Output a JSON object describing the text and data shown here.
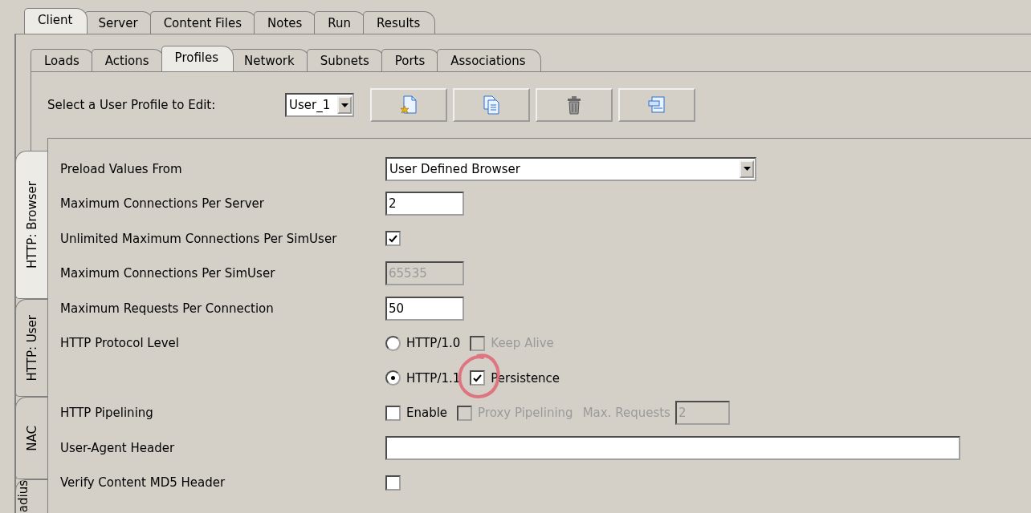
{
  "main_tabs": [
    {
      "label": "Client",
      "selected": true
    },
    {
      "label": "Server",
      "selected": false
    },
    {
      "label": "Content Files",
      "selected": false
    },
    {
      "label": "Notes",
      "selected": false
    },
    {
      "label": "Run",
      "selected": false
    },
    {
      "label": "Results",
      "selected": false
    }
  ],
  "sub_tabs": [
    {
      "label": "Loads",
      "selected": false
    },
    {
      "label": "Actions",
      "selected": false
    },
    {
      "label": "Profiles",
      "selected": true
    },
    {
      "label": "Network",
      "selected": false
    },
    {
      "label": "Subnets",
      "selected": false
    },
    {
      "label": "Ports",
      "selected": false
    },
    {
      "label": "Associations",
      "selected": false
    }
  ],
  "profile_bar": {
    "label": "Select a User Profile to Edit:",
    "value": "User_1",
    "buttons": [
      {
        "kind": "new"
      },
      {
        "kind": "copy"
      },
      {
        "kind": "delete"
      },
      {
        "kind": "window"
      }
    ]
  },
  "side_tabs": [
    {
      "label": "HTTP: Browser",
      "selected": true
    },
    {
      "label": "HTTP: User",
      "selected": false
    },
    {
      "label": "NAC",
      "selected": false
    },
    {
      "label": "adius",
      "selected": false
    }
  ],
  "rows": [
    {
      "label": "Preload Values From",
      "controls": [
        {
          "kind": "select",
          "value": "User Defined Browser"
        }
      ]
    },
    {
      "label": "Maximum Connections Per Server",
      "controls": [
        {
          "kind": "field",
          "value": "2",
          "disabled": false
        }
      ]
    },
    {
      "label": "Unlimited Maximum Connections Per SimUser",
      "controls": [
        {
          "kind": "checkbox",
          "checked": true,
          "disabled": false
        }
      ]
    },
    {
      "label": "Maximum Connections Per SimUser",
      "controls": [
        {
          "kind": "field",
          "value": "65535",
          "disabled": true
        }
      ]
    },
    {
      "label": "Maximum Requests Per Connection",
      "controls": [
        {
          "kind": "field",
          "value": "50",
          "disabled": false
        }
      ]
    },
    {
      "label": "HTTP Protocol Level",
      "controls": [
        {
          "kind": "radio",
          "text": "HTTP/1.0",
          "selected": false
        },
        {
          "kind": "checkbox",
          "text": "Keep Alive",
          "checked": false,
          "disabled": true
        }
      ]
    },
    {
      "controls": [
        {
          "kind": "radio",
          "text": "HTTP/1.1",
          "selected": true
        },
        {
          "kind": "checkbox",
          "text": "Persistence",
          "checked": true,
          "disabled": false,
          "circled": true
        }
      ]
    },
    {
      "label": "HTTP Pipelining",
      "controls": [
        {
          "kind": "checkbox",
          "text": "Enable",
          "checked": false,
          "disabled": false
        },
        {
          "kind": "checkbox",
          "text": "Proxy Pipelining",
          "checked": false,
          "disabled": true
        },
        {
          "kind": "caption",
          "text": "Max. Requests",
          "disabled": true
        },
        {
          "kind": "small_field",
          "value": "2",
          "disabled": true
        }
      ]
    },
    {
      "label": "User-Agent Header",
      "controls": [
        {
          "kind": "long_field",
          "disabled": false
        }
      ]
    },
    {
      "label": "Verify Content MD5 Header",
      "controls": [
        {
          "kind": "checkbox",
          "checked": false,
          "disabled": false
        }
      ]
    }
  ]
}
